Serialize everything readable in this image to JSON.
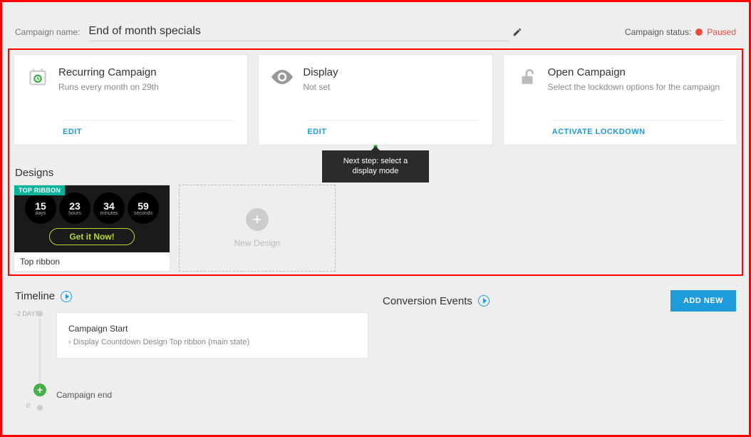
{
  "header": {
    "campaign_name_label": "Campaign name:",
    "campaign_name_value": "End of month specials",
    "status_label": "Campaign status:",
    "status_value": "Paused"
  },
  "cards": {
    "recurring": {
      "title": "Recurring Campaign",
      "subtitle": "Runs every month on 29th",
      "action": "EDIT"
    },
    "display": {
      "title": "Display",
      "subtitle": "Not set",
      "action": "EDIT",
      "tooltip": "Next step: select a display mode"
    },
    "lockdown": {
      "title": "Open Campaign",
      "subtitle": "Select the lockdown options for the campaign",
      "action": "ACTIVATE LOCKDOWN"
    }
  },
  "designs": {
    "heading": "Designs",
    "tile": {
      "badge": "TOP RIBBON",
      "countdown": {
        "days": "15",
        "hours": "23",
        "minutes": "34",
        "seconds": "59",
        "days_l": "days",
        "hours_l": "hours",
        "minutes_l": "minutes",
        "seconds_l": "seconds"
      },
      "cta": "Get it Now!",
      "label": "Top ribbon"
    },
    "new_design_label": "New Design"
  },
  "timeline_section": {
    "heading": "Timeline",
    "tag": "-2 DAYS",
    "zero": "0",
    "card_title": "Campaign Start",
    "card_sub": "Display Countdown Design Top ribbon (main state)",
    "end_label": "Campaign end"
  },
  "conversion": {
    "heading": "Conversion Events",
    "add_new": "ADD NEW"
  }
}
